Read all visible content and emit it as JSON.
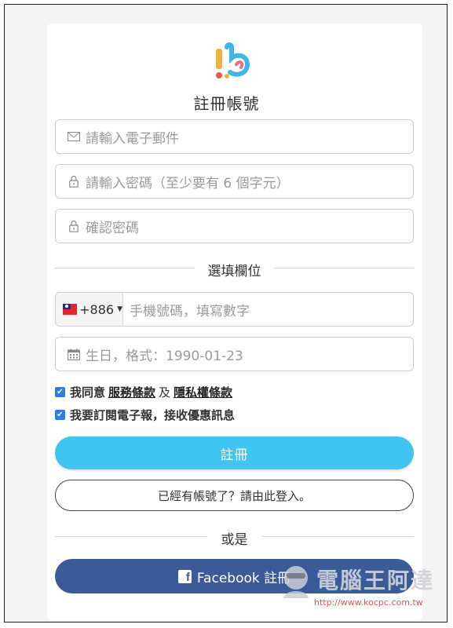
{
  "header": {
    "title": "註冊帳號"
  },
  "form": {
    "email_placeholder": "請輸入電子郵件",
    "password_placeholder": "請輸入密碼（至少要有 6 個字元）",
    "confirm_placeholder": "確認密碼",
    "optional_label": "選填欄位",
    "country_code": "+886",
    "phone_placeholder": "手機號碼，填寫數字",
    "birthday_placeholder": "生日，格式：1990-01-23"
  },
  "agreements": {
    "agree_prefix": "我同意",
    "terms_link": "服務條款",
    "and": "及",
    "privacy_link": "隱私權條款",
    "newsletter": "我要訂閱電子報，接收優惠訊息"
  },
  "actions": {
    "register_label": "註冊",
    "login_label": "已經有帳號了？請由此登入。",
    "or_label": "或是",
    "facebook_label": "Facebook 註冊"
  },
  "watermark": {
    "title": "電腦王阿達",
    "url": "http://www.kocpc.com.tw"
  },
  "colors": {
    "primary": "#40c4f1",
    "facebook": "#3a5a98",
    "checkbox": "#2b7de9"
  }
}
